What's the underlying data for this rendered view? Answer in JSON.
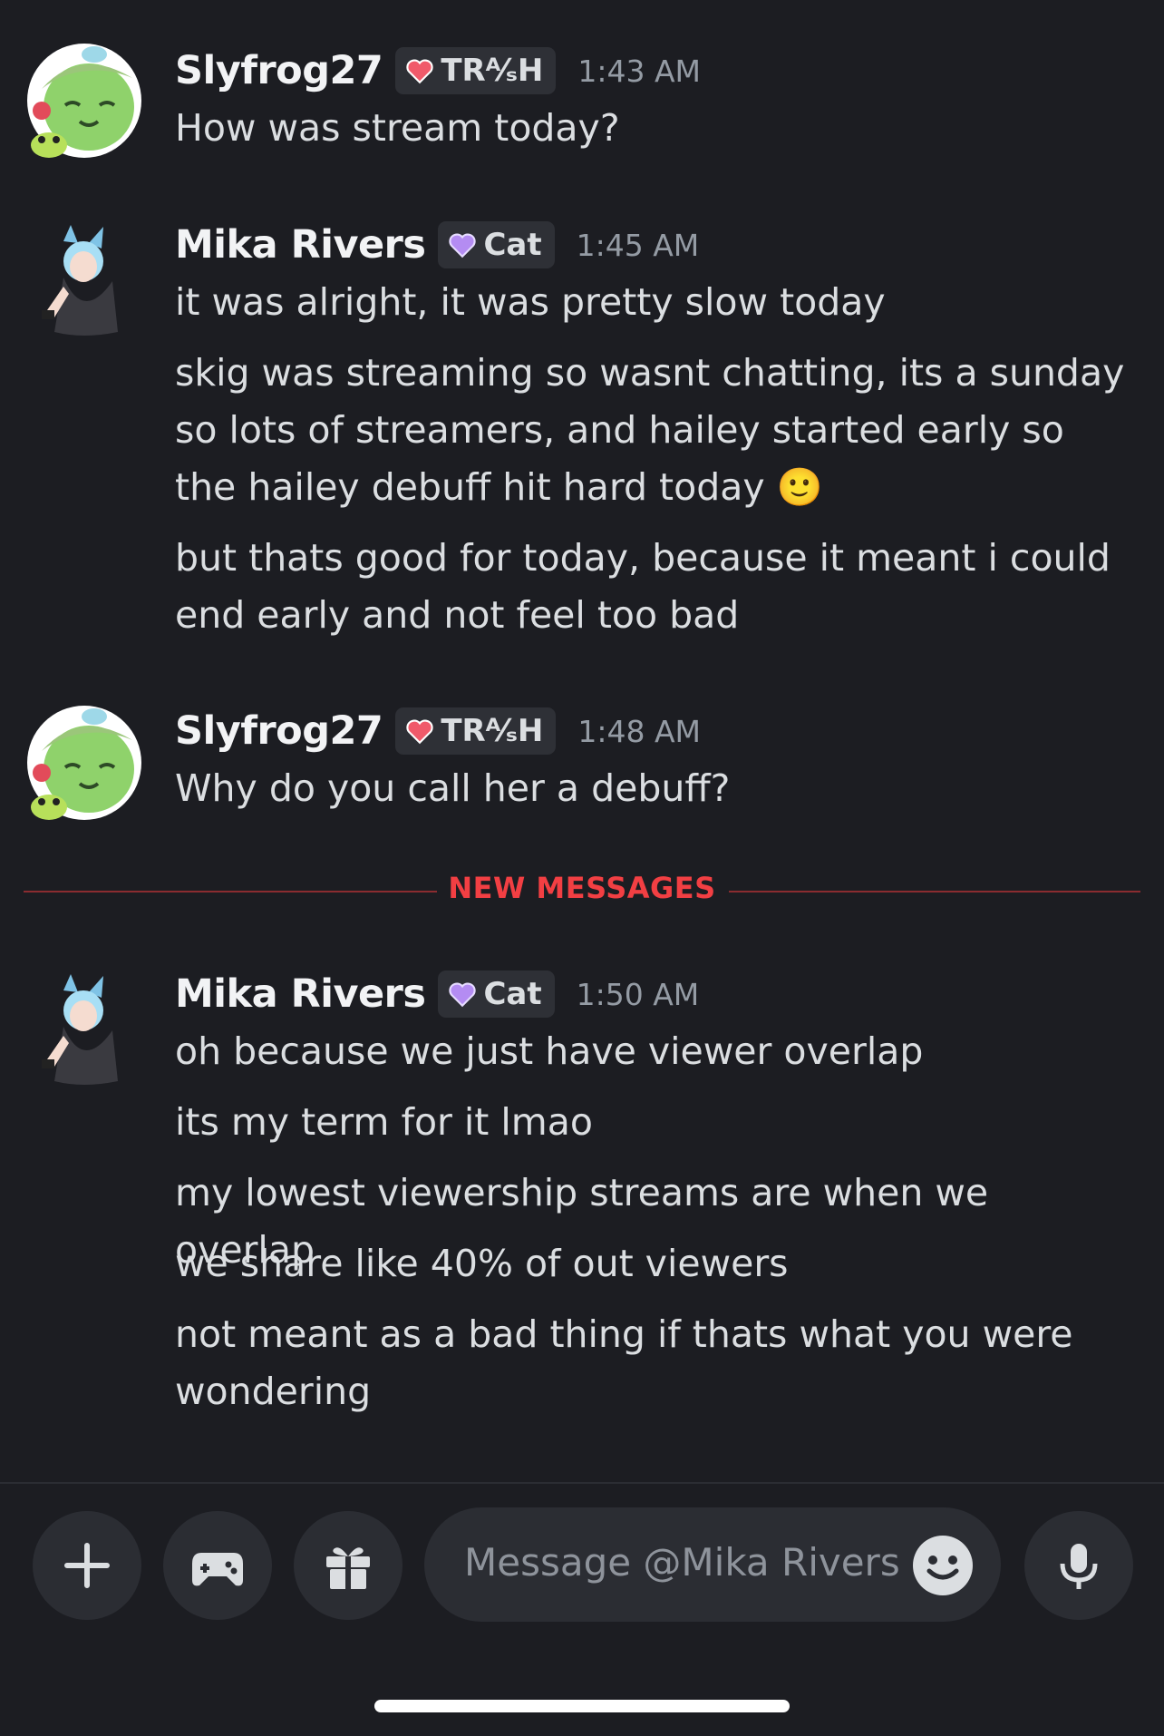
{
  "messages": [
    {
      "username": "Slyfrog27",
      "tag": "TR⁄⁄H",
      "tag_display": "TRᴬ⁄ₛH",
      "time": "1:43 AM",
      "lines": [
        "How was stream today?"
      ]
    },
    {
      "username": "Mika Rivers",
      "tag": "Cat",
      "time": "1:45 AM",
      "lines": [
        "it was alright, it was pretty slow today",
        "skig was streaming so wasnt chatting, its a sunday so lots of streamers, and hailey started early so the hailey debuff hit hard today 🙂",
        "but thats good for today, because it meant i could end early and not feel too bad"
      ]
    },
    {
      "username": "Slyfrog27",
      "tag": "TR⁄⁄H",
      "time": "1:48 AM",
      "lines": [
        "Why do you call her a debuff?"
      ]
    },
    {
      "username": "Mika Rivers",
      "tag": "Cat",
      "time": "1:50 AM",
      "lines": [
        "oh because we just have viewer overlap",
        "its my term for it lmao",
        "my lowest viewership streams are when we overlap",
        "we share like 40% of out viewers",
        "not meant as a bad thing if thats what you were wondering"
      ]
    }
  ],
  "divider": {
    "label": "NEW MESSAGES"
  },
  "composer": {
    "placeholder": "Message @Mika Rivers"
  },
  "icons": {
    "add": "plus-icon",
    "games": "gamepad-icon",
    "gift": "gift-icon",
    "emoji": "emoji-icon",
    "mic": "microphone-icon"
  },
  "colors": {
    "background": "#1c1d22",
    "divider": "#f23f43",
    "tag_bg": "#2e3036"
  }
}
